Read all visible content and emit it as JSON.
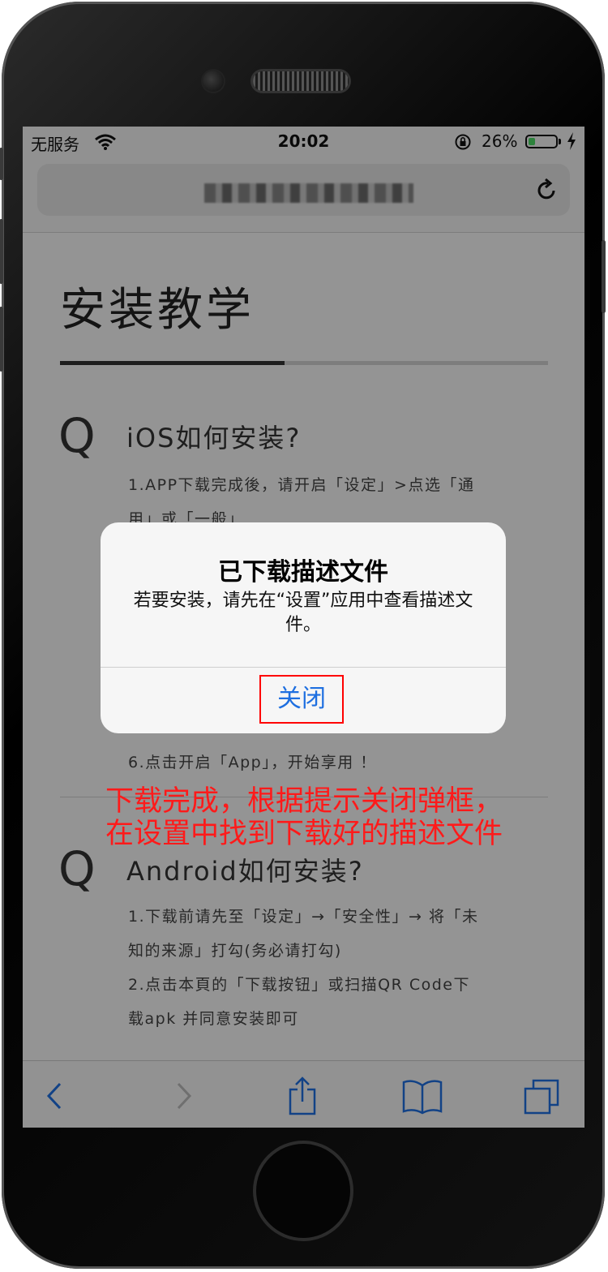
{
  "status_bar": {
    "carrier": "无服务",
    "time": "20:02",
    "battery": "26%",
    "battery_level": 0.26
  },
  "page": {
    "title": "安装教学",
    "progress": 0.46,
    "sections": [
      {
        "mark": "Q",
        "title": "iOS如何安装?",
        "lines": [
          "1.APP下载完成後，请开启「设定」>点选「通",
          "用」或「一般」"
        ]
      },
      {
        "mark": "Q",
        "title": "",
        "lines": [
          "6.点击开启「App」，开始享用 ！"
        ]
      },
      {
        "mark": "Q",
        "title": "Android如何安装?",
        "lines": [
          "1.下载前请先至「设定」→「安全性」→ 将「未",
          "知的来源」打勾(务必请打勾)",
          "2.点击本頁的「下载按钮」或扫描QR Code下",
          "载apk 并同意安装即可"
        ]
      }
    ]
  },
  "alert": {
    "title": "已下载描述文件",
    "message": "若要安装，请先在“设置”应用中查看描述文件。",
    "button": "关闭"
  },
  "annotation": {
    "line1": "下载完成，根据提示关闭弹框，",
    "line2": "在设置中找到下载好的描述文件"
  },
  "toolbar": {
    "icons": [
      "back-icon",
      "forward-icon",
      "share-icon",
      "bookmarks-icon",
      "tabs-icon"
    ]
  },
  "colors": {
    "accent": "#1e6fe0",
    "annotation": "#ff1a1a",
    "highlight_box": "#ff0000"
  }
}
